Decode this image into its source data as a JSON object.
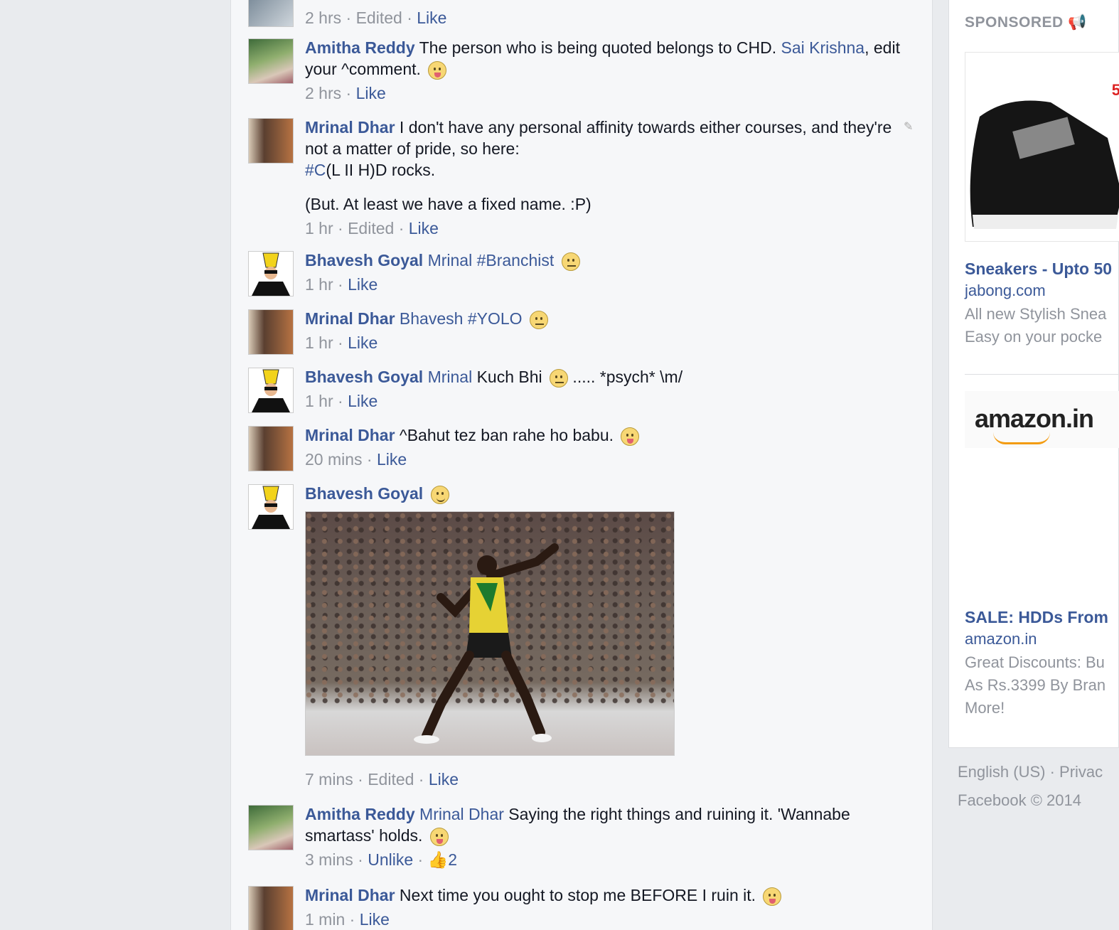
{
  "comments": [
    {
      "meta": {
        "time": "2 hrs",
        "edited": "Edited",
        "like": "Like"
      }
    },
    {
      "name": "Amitha Reddy",
      "text": " The person who is being quoted belongs to CHD. ",
      "mention": "Sai Krishna",
      "text2": ", edit your ^comment.",
      "meta": {
        "time": "2 hrs",
        "like": "Like"
      }
    },
    {
      "name": "Mrinal Dhar",
      "text": " I don't have any personal affinity towards either courses, and they're not a matter of pride, so here:",
      "hashtag": "#C",
      "text2": "(L II H)D rocks.",
      "text3": "(But. At least we have a fixed name. :P)",
      "meta": {
        "time": "1 hr",
        "edited": "Edited",
        "like": "Like"
      }
    },
    {
      "name": "Bhavesh Goyal",
      "mention": "Mrinal",
      "hashtag": "#Branchist",
      "meta": {
        "time": "1 hr",
        "like": "Like"
      }
    },
    {
      "name": "Mrinal Dhar",
      "mention": "Bhavesh",
      "hashtag": "#YOLO",
      "meta": {
        "time": "1 hr",
        "like": "Like"
      }
    },
    {
      "name": "Bhavesh Goyal",
      "mention": "Mrinal",
      "text": " Kuch Bhi ",
      "text2": " ..... *psych* \\m/",
      "meta": {
        "time": "1 hr",
        "like": "Like"
      }
    },
    {
      "name": "Mrinal Dhar",
      "text": " ^Bahut tez ban rahe ho babu. ",
      "meta": {
        "time": "20 mins",
        "like": "Like"
      }
    },
    {
      "name": "Bhavesh Goyal",
      "meta": {
        "time": "7 mins",
        "edited": "Edited",
        "like": "Like"
      }
    },
    {
      "name": "Amitha Reddy",
      "mention": "Mrinal Dhar",
      "text": " Saying the right things and ruining it. 'Wannabe smartass' holds. ",
      "meta": {
        "time": "3 mins",
        "like": "Unlike",
        "likes": "2"
      }
    },
    {
      "name": "Mrinal Dhar",
      "text": " Next time you ought to stop me BEFORE I ruin it. ",
      "meta": {
        "time": "1 min",
        "like": "Like"
      }
    }
  ],
  "meta_sep": " · ",
  "sidebar": {
    "sponsored": "SPONSORED",
    "ads": [
      {
        "price_badge": "5",
        "title": "Sneakers - Upto 50",
        "site": "jabong.com",
        "desc1": "All new Stylish Snea",
        "desc2": "Easy on your pocke"
      },
      {
        "logo": "amazon.in",
        "title": "SALE: HDDs From",
        "site": "amazon.in",
        "desc1": "Great Discounts: Bu",
        "desc2": "As Rs.3399 By Bran",
        "desc3": "More!"
      }
    ],
    "footer_line1": "English (US) · Privac",
    "footer_line2": "Facebook © 2014"
  },
  "icons": [
    "avatar",
    "tongue-emoji-icon",
    "unamused-emoji-icon",
    "smile-emoji-icon",
    "pencil-icon",
    "thumbs-up-icon",
    "megaphone-icon"
  ],
  "colors": {
    "link": "#3b5998",
    "meta": "#90949c",
    "feed_bg": "#f6f7f9",
    "page_bg": "#e9ebee",
    "active_bar": "#4267b2"
  }
}
